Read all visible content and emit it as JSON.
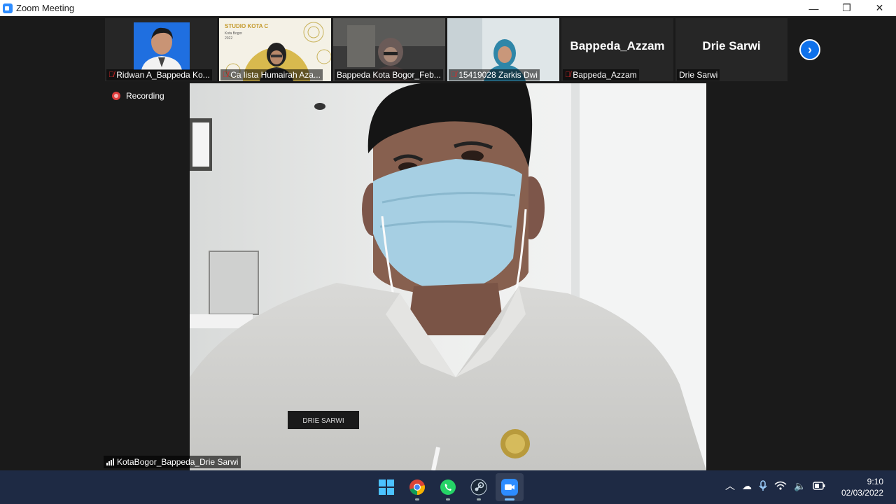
{
  "window": {
    "title": "Zoom Meeting",
    "controls": {
      "minimize": "—",
      "restore": "❐",
      "close": "✕"
    }
  },
  "gallery_strip": [
    {
      "name": "Ridwan A_Bappeda Ko...",
      "muted": true,
      "kind": "video"
    },
    {
      "name": "Ca lista Humairah Aza...",
      "muted": true,
      "kind": "video",
      "background_text": {
        "title": "STUDIO KOTA C",
        "subtitle": "Kota Bogor",
        "year": "2022"
      }
    },
    {
      "name": "Bappeda Kota Bogor_Feb...",
      "muted": false,
      "kind": "video"
    },
    {
      "name": "15419028 Zarkis Dwi",
      "muted": true,
      "kind": "video"
    },
    {
      "name": "Bappeda_Azzam",
      "muted": true,
      "kind": "name",
      "display": "Bappeda_Azzam"
    },
    {
      "name": "Drie Sarwi",
      "muted": false,
      "kind": "name",
      "display": "Drie Sarwi"
    }
  ],
  "gallery_next_icon": "chevron-right-icon",
  "recording": {
    "label": "Recording"
  },
  "active_speaker": {
    "name": "KotaBogor_Bappeda_Drie Sarwi",
    "name_tag_text": "DRIE SARWI"
  },
  "taskbar": {
    "apps": [
      {
        "name": "windows-start-icon",
        "active": false
      },
      {
        "name": "chrome-icon",
        "active": false
      },
      {
        "name": "whatsapp-icon",
        "active": false
      },
      {
        "name": "steam-icon",
        "active": false
      },
      {
        "name": "zoom-icon",
        "active": true
      }
    ],
    "tray_icons": [
      "chevron-up-icon",
      "onedrive-icon",
      "microphone-icon",
      "wifi-icon",
      "volume-icon",
      "battery-icon"
    ],
    "time": "9:10",
    "date": "02/03/2022"
  },
  "colors": {
    "zoom_blue": "#0e71eb",
    "muted_red": "#e02828",
    "recording_red": "#e03c3c",
    "taskbar": "#1e2a44"
  }
}
